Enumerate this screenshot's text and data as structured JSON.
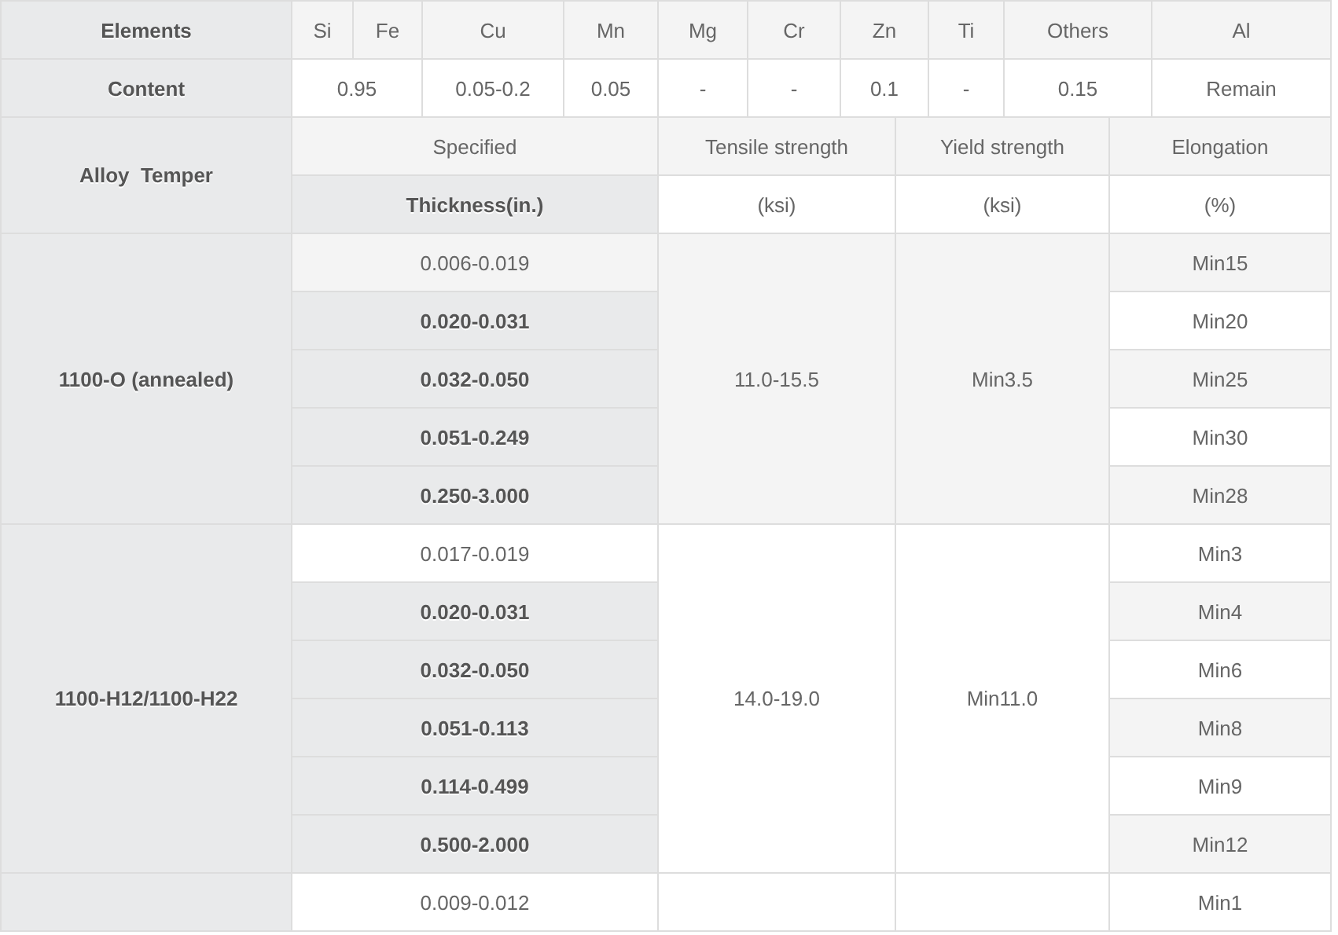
{
  "composition": {
    "elements_label": "Elements",
    "content_label": "Content",
    "columns": [
      {
        "elements": [
          "Si",
          "Fe"
        ],
        "content": "0.95"
      },
      {
        "elements": [
          "Cu"
        ],
        "content": "0.05-0.2"
      },
      {
        "elements": [
          "Mn"
        ],
        "content": "0.05"
      },
      {
        "elements": [
          "Mg"
        ],
        "content": "-"
      },
      {
        "elements": [
          "Cr"
        ],
        "content": "-"
      },
      {
        "elements": [
          "Zn"
        ],
        "content": "0.1"
      },
      {
        "elements": [
          "Ti"
        ],
        "content": "-"
      },
      {
        "elements": [
          "Others"
        ],
        "content": "0.15"
      },
      {
        "elements": [
          "Al"
        ],
        "content": "Remain"
      }
    ]
  },
  "properties": {
    "alloy_temper_label": "Alloy  Temper",
    "specified_label": "Specified",
    "thickness_label": "Thickness(in.)",
    "columns": [
      {
        "name": "Tensile strength",
        "unit": "(ksi)"
      },
      {
        "name": "Yield strength",
        "unit": "(ksi)"
      },
      {
        "name": "Elongation",
        "unit": "(%)"
      }
    ],
    "groups": [
      {
        "alloy_temper": "1100-O (annealed)",
        "tensile": "11.0-15.5",
        "yield": "Min3.5",
        "rows": [
          {
            "thickness": "0.006-0.019",
            "emphasized": false,
            "elongation": "Min15"
          },
          {
            "thickness": "0.020-0.031",
            "emphasized": true,
            "elongation": "Min20"
          },
          {
            "thickness": "0.032-0.050",
            "emphasized": true,
            "elongation": "Min25"
          },
          {
            "thickness": "0.051-0.249",
            "emphasized": true,
            "elongation": "Min30"
          },
          {
            "thickness": "0.250-3.000",
            "emphasized": true,
            "elongation": "Min28"
          }
        ]
      },
      {
        "alloy_temper": "1100-H12/1100-H22",
        "tensile": "14.0-19.0",
        "yield": "Min11.0",
        "rows": [
          {
            "thickness": "0.017-0.019",
            "emphasized": false,
            "elongation": "Min3"
          },
          {
            "thickness": "0.020-0.031",
            "emphasized": true,
            "elongation": "Min4"
          },
          {
            "thickness": "0.032-0.050",
            "emphasized": true,
            "elongation": "Min6"
          },
          {
            "thickness": "0.051-0.113",
            "emphasized": true,
            "elongation": "Min8"
          },
          {
            "thickness": "0.114-0.499",
            "emphasized": true,
            "elongation": "Min9"
          },
          {
            "thickness": "0.500-2.000",
            "emphasized": true,
            "elongation": "Min12"
          }
        ]
      },
      {
        "rows": [
          {
            "thickness": "0.009-0.012",
            "emphasized": false,
            "elongation": "Min1"
          }
        ]
      }
    ]
  }
}
